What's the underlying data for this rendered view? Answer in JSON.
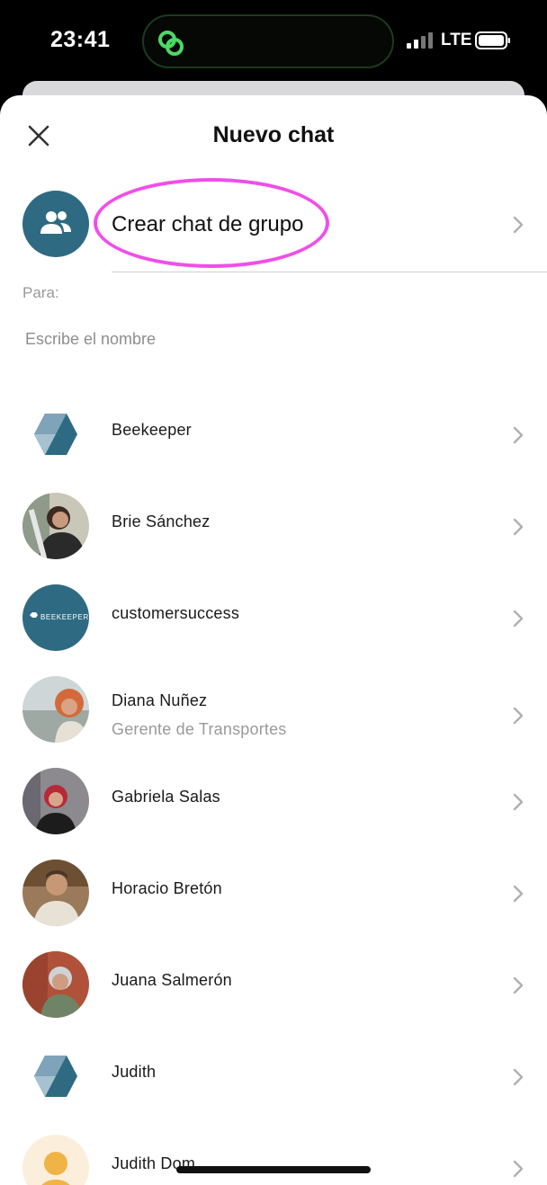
{
  "status": {
    "time": "23:41",
    "network": "LTE"
  },
  "header": {
    "title": "Nuevo chat"
  },
  "group_chat": {
    "label": "Crear chat de grupo",
    "icon": "people-icon"
  },
  "recipient": {
    "label": "Para:",
    "placeholder": "Escribe el nombre"
  },
  "contacts": [
    {
      "name": "Beekeeper",
      "subtitle": "",
      "avatar": "hexagon-logo"
    },
    {
      "name": "Brie Sánchez",
      "subtitle": "",
      "avatar": "photo"
    },
    {
      "name": "customersuccess",
      "subtitle": "",
      "avatar": "beekeeper-badge",
      "badge_text": "BEEKEEPER"
    },
    {
      "name": "Diana Nuñez",
      "subtitle": "Gerente de Transportes",
      "avatar": "photo"
    },
    {
      "name": "Gabriela Salas",
      "subtitle": "",
      "avatar": "photo"
    },
    {
      "name": "Horacio Bretón",
      "subtitle": "",
      "avatar": "photo"
    },
    {
      "name": "Juana Salmerón",
      "subtitle": "",
      "avatar": "photo"
    },
    {
      "name": "Judith",
      "subtitle": "",
      "avatar": "hexagon-logo"
    },
    {
      "name": "Judith Dom",
      "subtitle": "",
      "avatar": "default-user"
    }
  ],
  "colors": {
    "accent": "#2e6b82",
    "highlight": "#f04ee8",
    "island_icon": "#4cd964"
  }
}
